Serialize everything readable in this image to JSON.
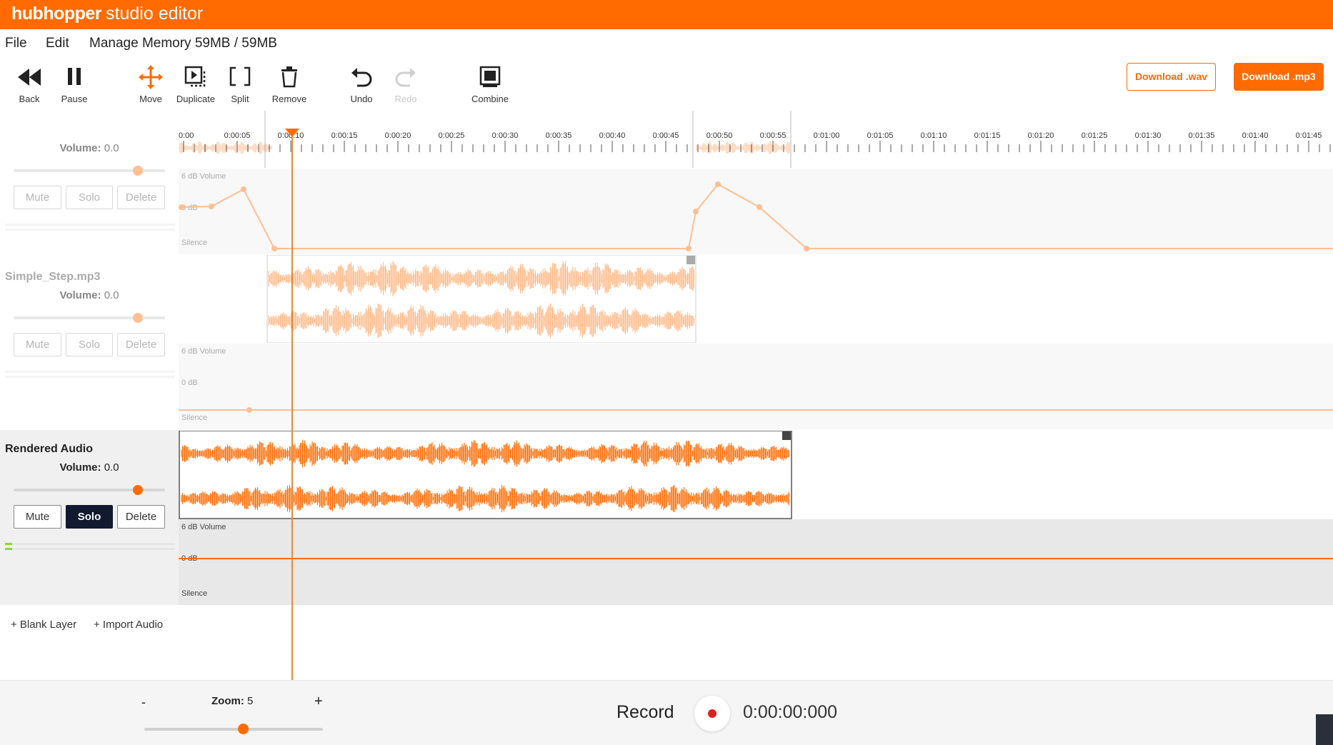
{
  "app": {
    "brand": "hubhopper",
    "title": "studio editor"
  },
  "menu": {
    "file": "File",
    "edit": "Edit",
    "memory": "Manage Memory 59MB / 59MB"
  },
  "toolbar": {
    "back": "Back",
    "pause": "Pause",
    "move": "Move",
    "duplicate": "Duplicate",
    "split": "Split",
    "remove": "Remove",
    "undo": "Undo",
    "redo": "Redo",
    "combine": "Combine",
    "download_wav": "Download .wav",
    "download_mp3": "Download .mp3"
  },
  "timeline": {
    "ticks": [
      "0:00",
      "0:00:05",
      "0:00:10",
      "0:00:15",
      "0:00:20",
      "0:00:25",
      "0:00:30",
      "0:00:35",
      "0:00:40",
      "0:00:45",
      "0:00:50",
      "0:00:55",
      "0:01:00",
      "0:01:05",
      "0:01:10",
      "0:01:15",
      "0:01:20",
      "0:01:25",
      "0:01:30",
      "0:01:35",
      "0:01:40",
      "0:01:45"
    ]
  },
  "tracks": [
    {
      "name": "",
      "volume_label": "Volume:",
      "volume_value": "0.0",
      "mute": "Mute",
      "solo": "Solo",
      "delete": "Delete",
      "solo_active": false,
      "volume_level": 0.82
    },
    {
      "name": "Simple_Step.mp3",
      "volume_label": "Volume:",
      "volume_value": "0.0",
      "mute": "Mute",
      "solo": "Solo",
      "delete": "Delete",
      "solo_active": false,
      "volume_level": 0.82
    },
    {
      "name": "Rendered Audio",
      "volume_label": "Volume:",
      "volume_value": "0.0",
      "mute": "Mute",
      "solo": "Solo",
      "delete": "Delete",
      "solo_active": true,
      "volume_level": 0.82
    }
  ],
  "envelope_labels": {
    "top": "6 dB Volume",
    "mid": "0 dB",
    "bottom": "Silence"
  },
  "add": {
    "blank_layer": "+ Blank Layer",
    "import_audio": "+ Import Audio"
  },
  "footer": {
    "zoom_minus": "-",
    "zoom_plus": "+",
    "zoom_label": "Zoom:",
    "zoom_value": "5",
    "record_label": "Record",
    "record_time": "0:00:00:000"
  },
  "colors": {
    "accent": "#ff6b00",
    "solo_active": "#111a2e",
    "record": "#e01e1e"
  }
}
